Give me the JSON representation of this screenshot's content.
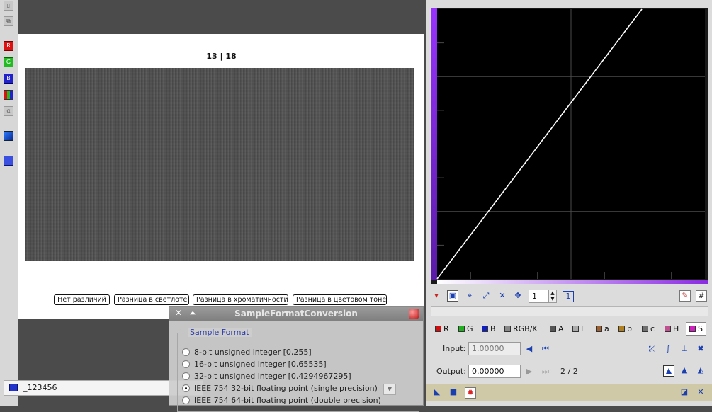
{
  "image_window": {
    "title": "13 | 18",
    "buttons": [
      "Нет различий",
      "Разница в светлоте",
      "Разница в хроматичности",
      "Разница в цветовом тоне"
    ]
  },
  "left_toolbar": {
    "channel_buttons": [
      "R",
      "G",
      "B"
    ]
  },
  "view_bar": {
    "name": "_123456"
  },
  "dialog": {
    "title": "SampleFormatConversion",
    "group_label": "Sample Format",
    "options": [
      {
        "label": "8-bit unsigned integer [0,255]",
        "selected": false
      },
      {
        "label": "16-bit unsigned integer [0,65535]",
        "selected": false
      },
      {
        "label": "32-bit unsigned integer [0,4294967295]",
        "selected": false
      },
      {
        "label": "IEEE 754 32-bit floating point (single precision)",
        "selected": true
      },
      {
        "label": "IEEE 754 64-bit floating point (double precision)",
        "selected": false
      }
    ]
  },
  "curves": {
    "zoom": "1",
    "channels": [
      {
        "label": "R",
        "color": "#d01010"
      },
      {
        "label": "G",
        "color": "#20b020"
      },
      {
        "label": "B",
        "color": "#1020c0"
      },
      {
        "label": "RGB/K",
        "color": "#888888"
      },
      {
        "label": "A",
        "color": "#555555"
      },
      {
        "label": "L",
        "color": "#aaaaaa"
      },
      {
        "label": "a",
        "color": "#a06030"
      },
      {
        "label": "b",
        "color": "#b08020"
      },
      {
        "label": "c",
        "color": "#707070"
      },
      {
        "label": "H",
        "color": "#c05090"
      },
      {
        "label": "S",
        "color": "#d020c0"
      }
    ],
    "selected_channel": "S",
    "input_label": "Input:",
    "input_value": "1.00000",
    "output_label": "Output:",
    "output_value": "0.00000",
    "point_counter": "2 / 2",
    "curve_points": [
      [
        0.0,
        0.0
      ],
      [
        0.7645,
        1.0
      ]
    ],
    "colors": {
      "graph_bg": "#000000",
      "grid": "#4a4a4a",
      "curve": "#ffffff",
      "gradient_start": "#9933ff",
      "gradient_end": "#5a1aa8"
    }
  }
}
